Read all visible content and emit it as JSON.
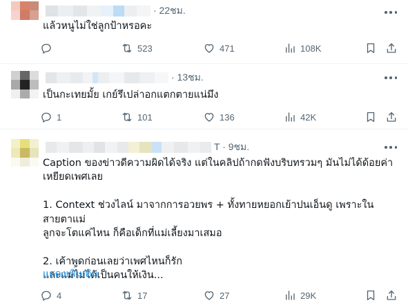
{
  "tweets": [
    {
      "time": "· 22ชม.",
      "text": "แล้วหนูไม่ใช่ลูกป้าหรอคะ",
      "show_more": "",
      "replies": "",
      "retweets": "523",
      "likes": "471",
      "views": "108K"
    },
    {
      "time": "· 13ชม.",
      "text": "เป็นกะเทยมั้ย เกย์รึเปล่าอกแตกตายแน่มึง",
      "show_more": "",
      "replies": "1",
      "retweets": "101",
      "likes": "136",
      "views": "42K"
    },
    {
      "time": "T · 9ชม.",
      "text": "Caption ของข่าวดีความผิดได้จริง แต่ในคลิปถ้ากดฟังบริบทรวมๆ มันไม่ได้ด้อยค่า\nเหยียดเพศเลย\n\n1. Context ช่วงไลน์ มาจากการอวยพร + ทั้งทายหยอกเย้าปนเอ็นดู เพราะในสายตาแม่\nลูกจะโตแค่ไหน ก็คือเด็กที่แม่เลี้ยงมาเสมอ\n\n2. เค้าพูดก่อนเลยว่าเพศไหนก็รัก\nและแม่ไม่ได้เป็นคนให้เงิน...",
      "show_more": "แสดงเพิ่มเติม",
      "replies": "4",
      "retweets": "17",
      "likes": "27",
      "views": "29K"
    }
  ],
  "colors": {
    "text": "#0f1419",
    "secondary": "#536471",
    "link": "#1d9bf0",
    "divider": "#eff3f4"
  },
  "icons": [
    "reply-icon",
    "retweet-icon",
    "like-icon",
    "views-icon",
    "bookmark-icon",
    "share-icon",
    "more-icon"
  ]
}
